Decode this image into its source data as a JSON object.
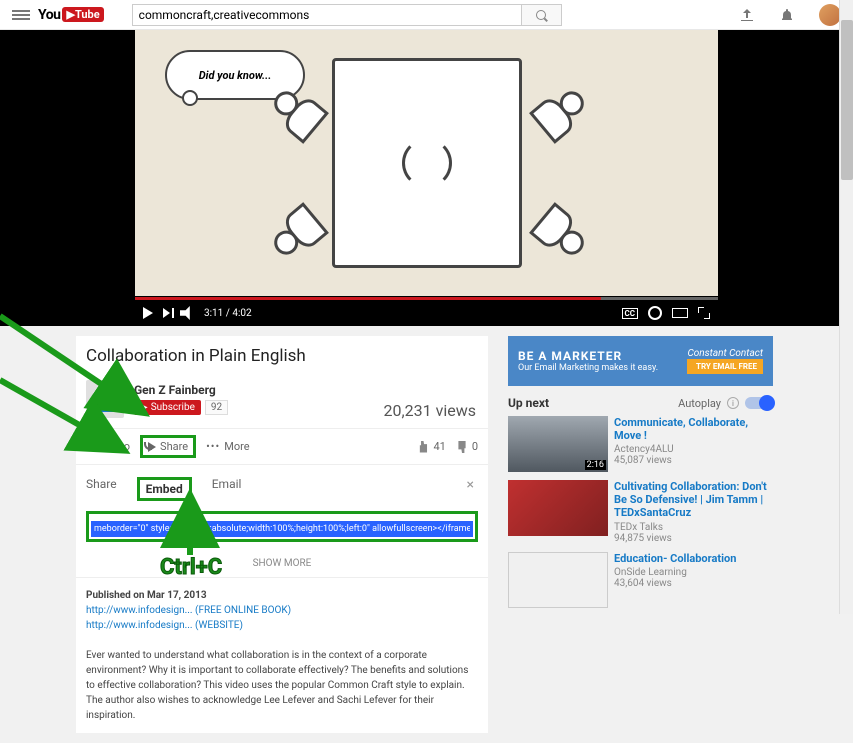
{
  "search": {
    "value": "commoncraft,creativecommons"
  },
  "logo": {
    "you": "You",
    "tube": "Tube"
  },
  "video": {
    "cloud_text": "Did you know...",
    "time": "3:11 / 4:02",
    "cc": "CC",
    "title": "Collaboration in Plain English",
    "channel": "Gen Z Fainberg",
    "subscribe": "Subscribe",
    "sub_count": "92",
    "views": "20,231 views",
    "addto": "Add to",
    "share": "Share",
    "more": "More",
    "likes": "41",
    "dislikes": "0"
  },
  "share_panel": {
    "share_tab": "Share",
    "embed_tab": "Embed",
    "email_tab": "Email",
    "embed_code": "meborder=\"0\" style=\"position:absolute;width:100%;height:100%;left:0\" allowfullscreen></iframe></div>",
    "show_more": "SHOW MORE"
  },
  "description": {
    "published": "Published on Mar 17, 2013",
    "link1": "http://www.infodesign... (FREE ONLINE BOOK)",
    "link2": "http://www.infodesign... (WEBSITE)",
    "body": "Ever wanted to understand what collaboration is in the context of a corporate environment? Why it is important to collaborate effectively? The benefits and solutions to effective collaboration? This video uses the popular Common Craft style to explain. The author also wishes to acknowledge Lee Lefever and Sachi Lefever for their inspiration."
  },
  "sidebar": {
    "ad_title": "BE A MARKETER",
    "ad_sub": "Our Email Marketing makes it easy.",
    "ad_brand": "Constant Contact",
    "ad_cta": "TRY EMAIL FREE",
    "upnext": "Up next",
    "autoplay": "Autoplay",
    "recs": [
      {
        "title": "Communicate, Collaborate, Move !",
        "channel": "Actency4ALU",
        "views": "45,087 views",
        "duration": "2:16"
      },
      {
        "title": "Cultivating Collaboration: Don't Be So Defensive! | Jim Tamm | TEDxSantaCruz",
        "channel": "TEDx Talks",
        "views": "94,875 views",
        "duration": ""
      },
      {
        "title": "Education- Collaboration",
        "channel": "OnSide Learning",
        "views": "43,604 views",
        "duration": ""
      }
    ]
  },
  "annotation": {
    "ctrlc": "Ctrl+C"
  }
}
